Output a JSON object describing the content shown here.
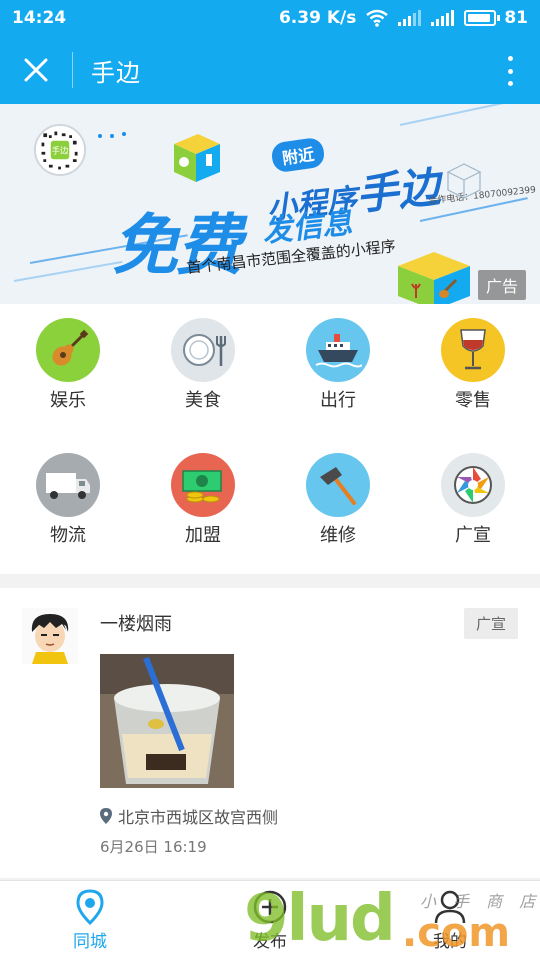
{
  "status_bar": {
    "time": "14:24",
    "speed": "6.39 K/s",
    "network_type": "4G",
    "battery": "81"
  },
  "header": {
    "title": "手边",
    "close_icon": "close-icon",
    "more_icon": "more-vertical-icon"
  },
  "banner": {
    "big_text": "免费",
    "nearby_badge": "附近",
    "mini_title_part1": "小程序",
    "mini_title_part2": "手边",
    "publish_text": "发信息",
    "phone": "合作电话：18070092399",
    "subtitle": "首个南昌市范围全覆盖的小程序",
    "ad_label": "广告",
    "colors": {
      "primary": "#1e8de8",
      "green": "#8ccf3c",
      "yellow": "#f6d23a"
    }
  },
  "categories": [
    {
      "label": "娱乐",
      "icon": "guitar-icon",
      "color": "#8bd13b"
    },
    {
      "label": "美食",
      "icon": "plate-icon",
      "color": "#dfe5e8"
    },
    {
      "label": "出行",
      "icon": "ship-icon",
      "color": "#67c6ee"
    },
    {
      "label": "零售",
      "icon": "wine-glass-icon",
      "color": "#f5c525"
    },
    {
      "label": "物流",
      "icon": "truck-icon",
      "color": "#a6abb0"
    },
    {
      "label": "加盟",
      "icon": "money-icon",
      "color": "#e86552"
    },
    {
      "label": "维修",
      "icon": "hammer-icon",
      "color": "#67c6ee"
    },
    {
      "label": "广宣",
      "icon": "aperture-icon",
      "color": "#e3e8eb"
    }
  ],
  "post": {
    "author": "一楼烟雨",
    "tag": "广宣",
    "location": "北京市西城区故宫西侧",
    "time": "6月26日 16:19"
  },
  "tabbar": {
    "tabs": [
      {
        "label": "同城",
        "icon": "location-pin-icon",
        "active": true
      },
      {
        "label": "发布",
        "icon": "add-circle-icon",
        "active": false
      },
      {
        "label": "我的",
        "icon": "user-icon",
        "active": false
      }
    ],
    "active_color": "#1ea7ee"
  },
  "watermark": {
    "logo": "9lud",
    "domain": ".com",
    "shop": "小 手 商 店"
  }
}
